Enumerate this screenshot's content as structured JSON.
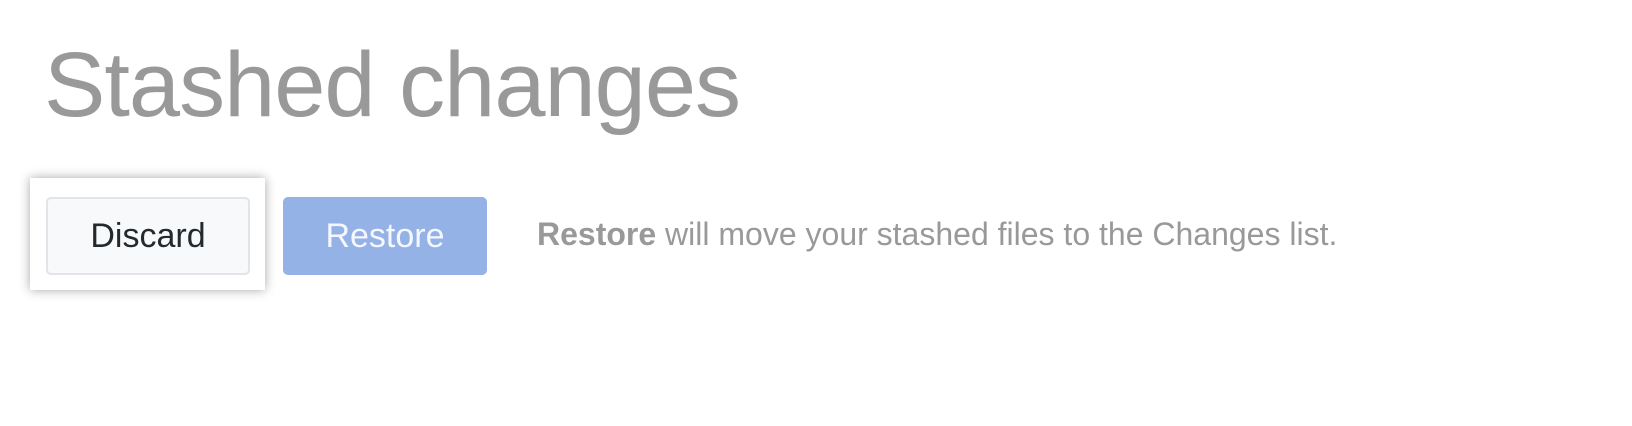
{
  "title": "Stashed changes",
  "buttons": {
    "discard": "Discard",
    "restore": "Restore"
  },
  "description": {
    "bold": "Restore",
    "rest": " will move your stashed files to the Changes list."
  }
}
